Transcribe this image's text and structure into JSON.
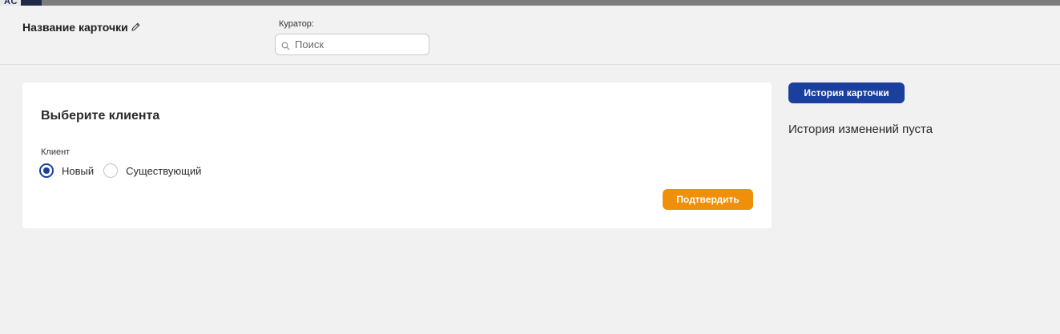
{
  "topbar": {
    "avatar_initials": "AC"
  },
  "header": {
    "card_title": "Название карточки",
    "curator_label": "Куратор:",
    "search_placeholder": "Поиск",
    "search_value": ""
  },
  "panel": {
    "title": "Выберите клиента",
    "field_label": "Клиент",
    "radio_options": [
      {
        "label": "Новый",
        "checked": true
      },
      {
        "label": "Существующий",
        "checked": false
      }
    ],
    "confirm_label": "Подтвердить"
  },
  "history": {
    "button_label": "История карточки",
    "empty_text": "История изменений пуста"
  },
  "colors": {
    "primary": "#1a3f9c",
    "accent": "#ef8f0a",
    "background": "#f1f1f1"
  },
  "icons": {
    "edit": "pencil-icon",
    "search": "search-icon"
  }
}
